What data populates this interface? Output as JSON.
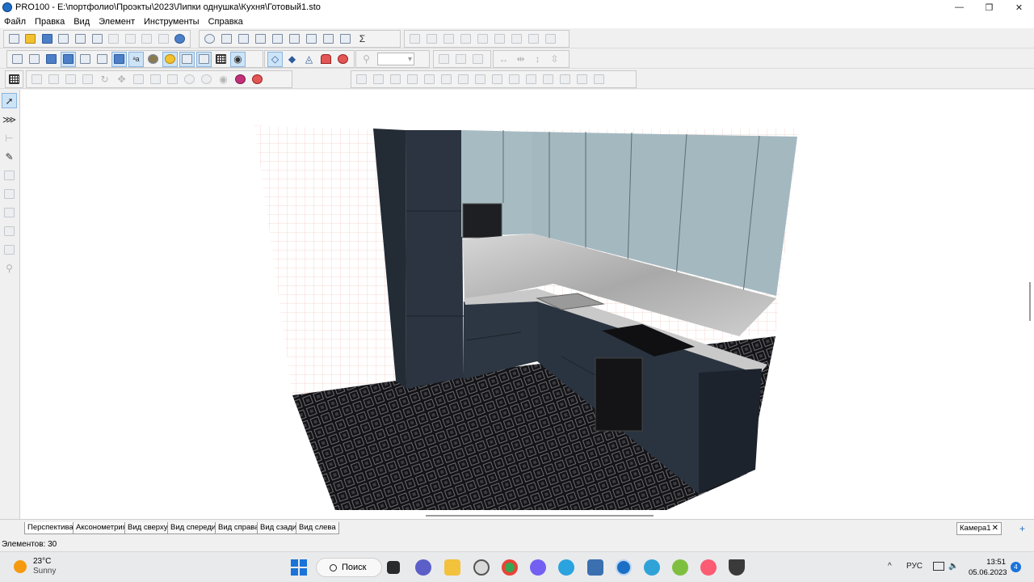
{
  "window": {
    "title": "PRO100 - E:\\портфолио\\Проэкты\\2023\\Липки однушка\\Кухня\\Готовый1.sto",
    "minimize": "—",
    "maximize": "❐",
    "close": "✕"
  },
  "menu": {
    "items": [
      "Файл",
      "Правка",
      "Вид",
      "Элемент",
      "Инструменты",
      "Справка"
    ]
  },
  "view_tabs": [
    "Перспектива",
    "Аксонометрия",
    "Вид сверху",
    "Вид спереди",
    "Вид справа",
    "Вид сзади",
    "Вид слева"
  ],
  "camera_tab": {
    "label": "Камера1",
    "close": "✕",
    "add": "+"
  },
  "status": {
    "elements": "Элементов: 30"
  },
  "taskbar": {
    "weather_temp": "23°C",
    "weather_cond": "Sunny",
    "search_label": "Поиск",
    "tray_chevron": "^",
    "language": "РУС",
    "time": "13:51",
    "date": "05.06.2023",
    "notifications": "4"
  },
  "colors": {
    "cabinet": "#2c3541",
    "upper_fronts": "#a8bcc4",
    "countertop": "#c7c7c7",
    "floor": "#1a1a1e",
    "grid": "#f3d0c8",
    "accent": "#1a73d9"
  }
}
